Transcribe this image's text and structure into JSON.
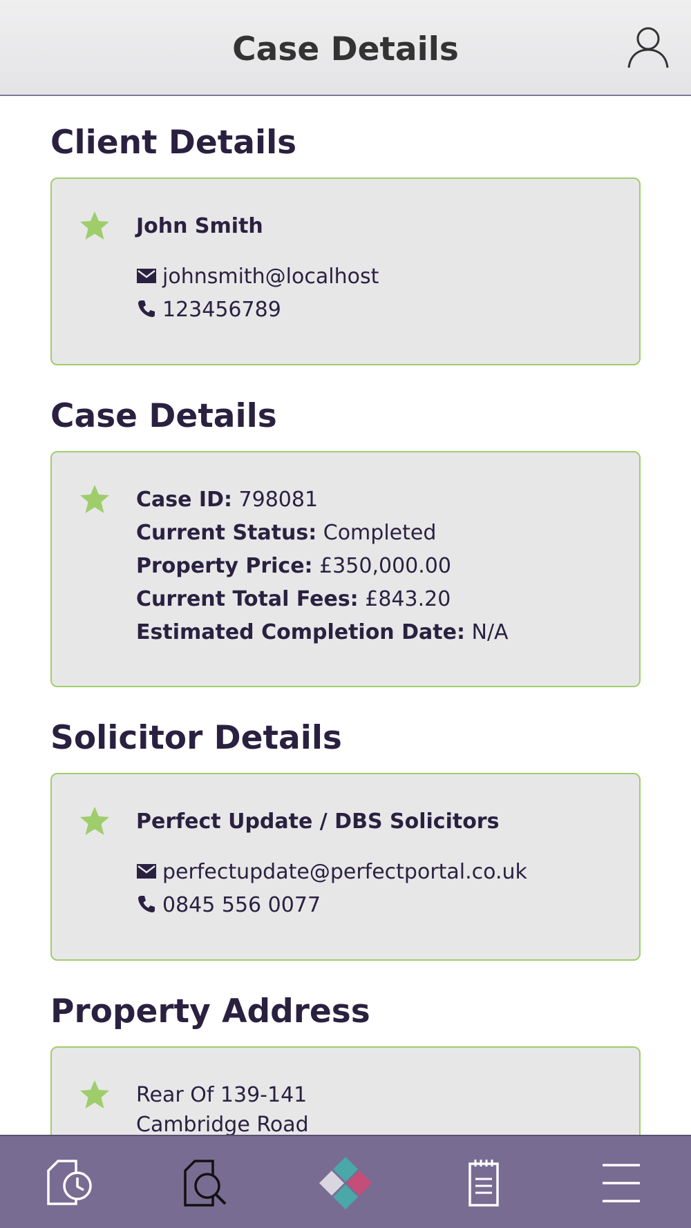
{
  "header": {
    "title": "Case Details"
  },
  "client": {
    "section_title": "Client Details",
    "name": "John Smith",
    "email": "johnsmith@localhost",
    "phone": "123456789"
  },
  "case": {
    "section_title": "Case Details",
    "rows": [
      {
        "label": "Case ID:",
        "value": "798081"
      },
      {
        "label": "Current Status:",
        "value": "Completed"
      },
      {
        "label": "Property Price:",
        "value": "£350,000.00"
      },
      {
        "label": "Current Total Fees:",
        "value": "£843.20"
      },
      {
        "label": "Estimated Completion Date:",
        "value": "N/A"
      }
    ]
  },
  "solicitor": {
    "section_title": "Solicitor Details",
    "name": "Perfect Update / DBS Solicitors",
    "email": "perfectupdate@perfectportal.co.uk",
    "phone": "0845 556 0077"
  },
  "property": {
    "section_title": "Property Address",
    "lines": [
      "Rear Of 139-141",
      "Cambridge Road"
    ]
  },
  "icons": {
    "star_color": "#9fcd6c",
    "nav": [
      "case-history-icon",
      "search-documents-icon",
      "home-logo-icon",
      "notes-icon",
      "menu-icon"
    ]
  }
}
